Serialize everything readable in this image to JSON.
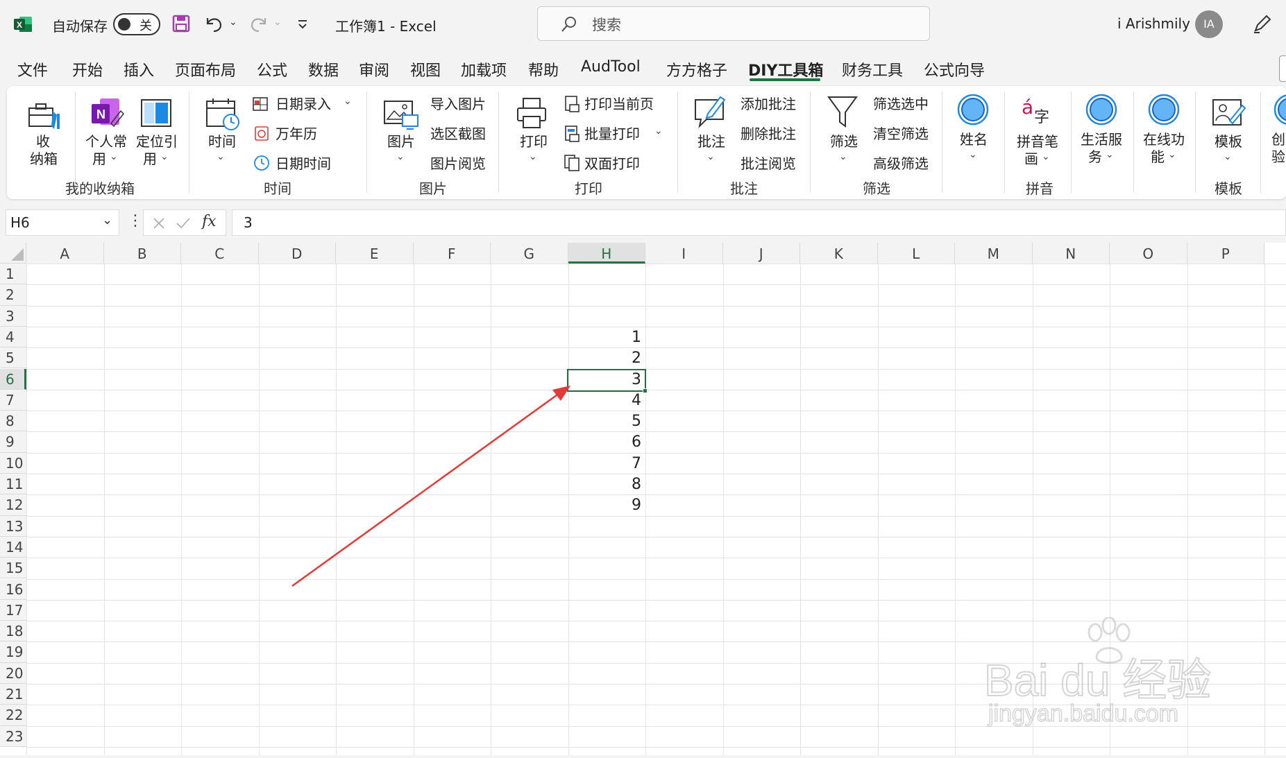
{
  "titlebar": {
    "autosave_label": "自动保存",
    "autosave_state": "关",
    "doc_title": "工作簿1  -  Excel",
    "search_placeholder": "搜索",
    "user_name": "i Arishmily",
    "avatar_initials": "IA"
  },
  "tabs": [
    "文件",
    "开始",
    "插入",
    "页面布局",
    "公式",
    "数据",
    "审阅",
    "视图",
    "加载项",
    "帮助",
    "AudTool",
    "方方格子",
    "DIY工具箱",
    "财务工具",
    "公式向导"
  ],
  "active_tab": "DIY工具箱",
  "ribbon": {
    "shoubox": {
      "line1": "收",
      "line2": "纳箱"
    },
    "personal": {
      "line1": "个人常",
      "line2": "用"
    },
    "locate": {
      "line1": "定位引",
      "line2": "用"
    },
    "group_storage": "我的收纳箱",
    "time_btn": "时间",
    "date_entry": "日期录入",
    "calendar": "万年历",
    "datetime": "日期时间",
    "group_time": "时间",
    "picture_btn": "图片",
    "import_pic": "导入图片",
    "area_shot": "选区截图",
    "pic_view": "图片阅览",
    "group_picture": "图片",
    "print_btn": "打印",
    "print_current": "打印当前页",
    "batch_print": "批量打印",
    "duplex_print": "双面打印",
    "group_print": "打印",
    "comment_btn": "批注",
    "add_comment": "添加批注",
    "delete_comment": "删除批注",
    "view_comment": "批注阅览",
    "group_comment": "批注",
    "filter_btn": "筛选",
    "filter_selected": "筛选选中",
    "clear_filter": "清空筛选",
    "advanced_filter": "高级筛选",
    "group_filter": "筛选",
    "name_btn": "姓名",
    "pinyin": {
      "line1": "拼音笔",
      "line2": "画"
    },
    "group_pinyin": "拼音",
    "life": {
      "line1": "生活服",
      "line2": "务"
    },
    "online": {
      "line1": "在线功",
      "line2": "能"
    },
    "template_btn": "模板",
    "group_template": "模板",
    "create": {
      "line1": "创",
      "line2": "验"
    }
  },
  "formula_bar": {
    "cell_ref": "H6",
    "fx": "fx",
    "value": "3"
  },
  "columns": [
    "A",
    "B",
    "C",
    "D",
    "E",
    "F",
    "G",
    "H",
    "I",
    "J",
    "K",
    "L",
    "M",
    "N",
    "O",
    "P"
  ],
  "rows": [
    "1",
    "2",
    "3",
    "4",
    "5",
    "6",
    "7",
    "8",
    "9",
    "10",
    "11",
    "12",
    "13",
    "14",
    "15",
    "16",
    "17",
    "18",
    "19",
    "20",
    "21",
    "22",
    "23"
  ],
  "selected_cell": "H6",
  "h_values": [
    {
      "row": "4",
      "value": "1"
    },
    {
      "row": "5",
      "value": "2"
    },
    {
      "row": "6",
      "value": "3"
    },
    {
      "row": "7",
      "value": "4"
    },
    {
      "row": "8",
      "value": "5"
    },
    {
      "row": "9",
      "value": "6"
    },
    {
      "row": "10",
      "value": "7"
    },
    {
      "row": "11",
      "value": "8"
    },
    {
      "row": "12",
      "value": "9"
    }
  ],
  "watermark": {
    "brand": "Bai du 经验",
    "url": "jingyan.baidu.com"
  },
  "colors": {
    "excel_green": "#217346",
    "annotation_red": "#e53935",
    "accent_blue": "#1e88e5"
  }
}
